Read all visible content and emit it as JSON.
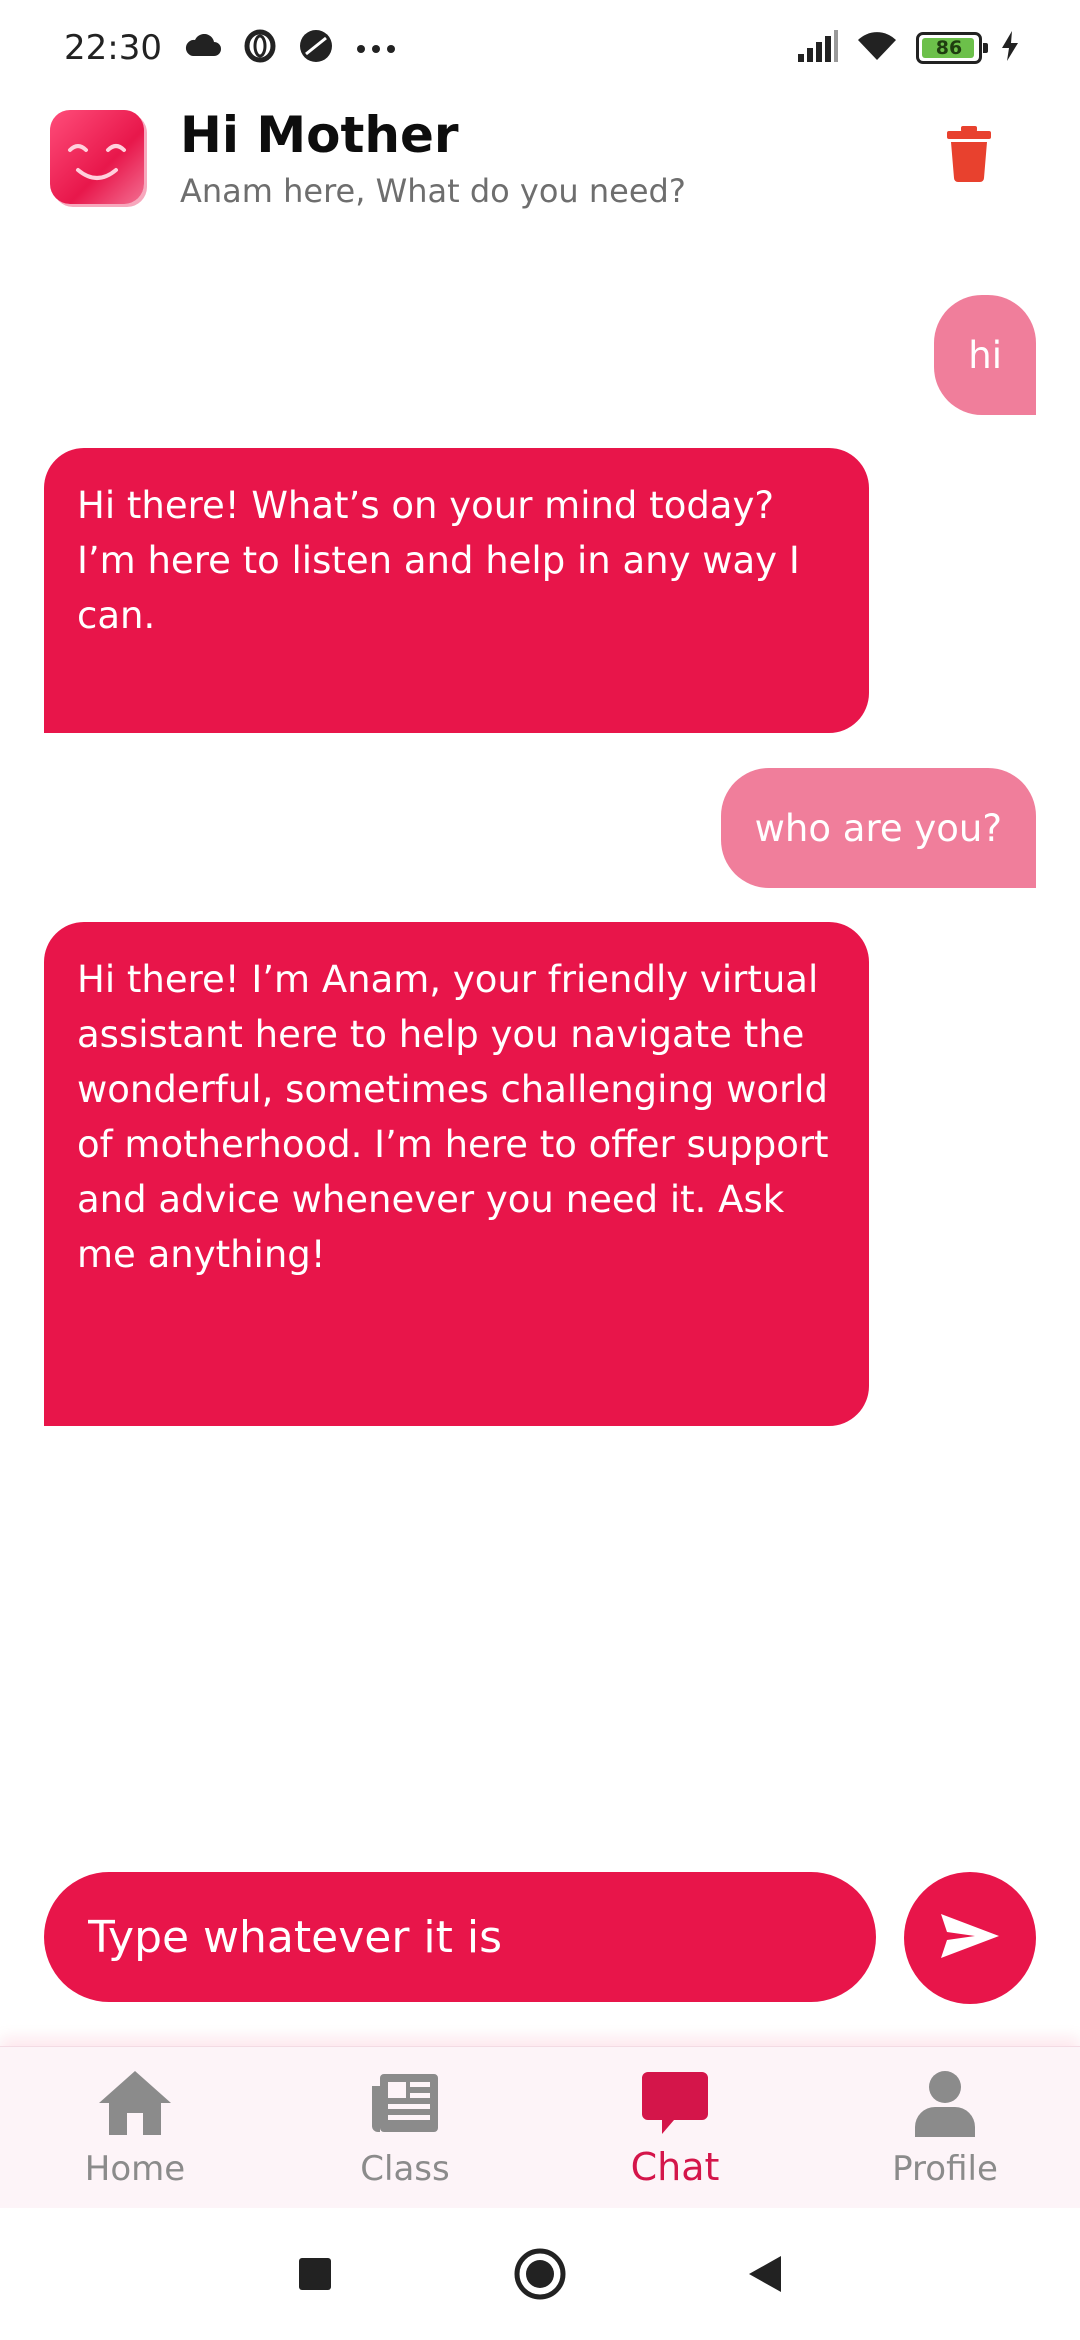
{
  "status_bar": {
    "time": "22:30",
    "battery_level": "86",
    "icons": [
      "cloud-icon",
      "opera-icon",
      "vpn-icon",
      "more-dots-icon",
      "signal-icon",
      "wifi-icon",
      "battery-icon",
      "charging-icon"
    ]
  },
  "header": {
    "title": "Hi Mother",
    "subtitle": "Anam here, What do you need?",
    "avatar_icon": "smiley-face-icon",
    "delete_icon": "trash-icon"
  },
  "messages": [
    {
      "role": "user",
      "text": "hi"
    },
    {
      "role": "assistant",
      "text": "Hi there!  What’s on your mind today? I’m here to listen and help in any way I can."
    },
    {
      "role": "user",
      "text": "who are you?"
    },
    {
      "role": "assistant",
      "text": "Hi there! I’m Anam, your friendly virtual assistant here to help you navigate the wonderful, sometimes challenging world of motherhood.  I’m here to offer support and advice whenever you need it.  Ask me anything!"
    }
  ],
  "composer": {
    "placeholder": "Type whatever it is",
    "send_icon": "send-icon"
  },
  "bottom_nav": {
    "items": [
      {
        "label": "Home",
        "icon": "home-icon",
        "active": false
      },
      {
        "label": "Class",
        "icon": "newspaper-icon",
        "active": false
      },
      {
        "label": "Chat",
        "icon": "chat-bubble-icon",
        "active": true
      },
      {
        "label": "Profile",
        "icon": "person-icon",
        "active": false
      }
    ]
  },
  "colors": {
    "accent": "#e8154a",
    "user_bubble": "#f07e9b",
    "nav_inactive": "#8b8b8b",
    "delete_icon": "#e8412e",
    "nav_background": "#fdf4f8"
  }
}
